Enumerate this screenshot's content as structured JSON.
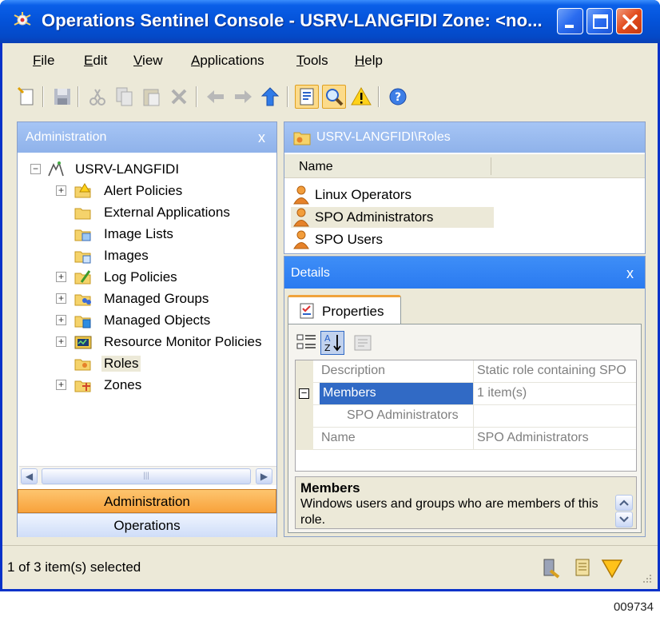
{
  "window": {
    "title": "Operations Sentinel Console - USRV-LANGFIDI  Zone: <no...",
    "minimize_icon": "minimize-icon",
    "maximize_icon": "maximize-icon",
    "close_icon": "close-icon"
  },
  "menu": {
    "items": [
      {
        "label": "File",
        "accel": "F"
      },
      {
        "label": "Edit",
        "accel": "E"
      },
      {
        "label": "View",
        "accel": "V"
      },
      {
        "label": "Applications",
        "accel": "A"
      },
      {
        "label": "Tools",
        "accel": "T"
      },
      {
        "label": "Help",
        "accel": "H"
      }
    ]
  },
  "toolbar": {
    "icons": [
      "new-icon",
      "save-icon",
      "cut-icon",
      "copy-icon",
      "paste-icon",
      "delete-icon",
      "back-icon",
      "forward-icon",
      "up-icon",
      "properties-icon",
      "find-icon",
      "alert-icon",
      "help-icon"
    ]
  },
  "left_pane": {
    "title": "Administration",
    "close_label": "x",
    "tree_root": "USRV-LANGFIDI",
    "tree_items": [
      {
        "label": "Alert Policies",
        "expandable": true
      },
      {
        "label": "External Applications",
        "expandable": false
      },
      {
        "label": "Image Lists",
        "expandable": false
      },
      {
        "label": "Images",
        "expandable": false
      },
      {
        "label": "Log Policies",
        "expandable": true
      },
      {
        "label": "Managed Groups",
        "expandable": true
      },
      {
        "label": "Managed Objects",
        "expandable": true
      },
      {
        "label": "Resource Monitor Policies",
        "expandable": true
      },
      {
        "label": "Roles",
        "expandable": false,
        "selected": true
      },
      {
        "label": "Zones",
        "expandable": true
      }
    ],
    "nav_buttons": {
      "administration": "Administration",
      "operations": "Operations"
    }
  },
  "roles_pane": {
    "title": "USRV-LANGFIDI\\Roles",
    "column_name": "Name",
    "items": [
      "Linux Operators",
      "SPO Administrators",
      "SPO Users"
    ]
  },
  "details": {
    "title": "Details",
    "close_label": "x",
    "tab_label": "Properties",
    "grid": {
      "description_name": "Description",
      "description_value": "Static role containing SPO",
      "members_name": "Members",
      "members_value": "1 item(s)",
      "member_child_name": "SPO Administrators",
      "member_child_value": "",
      "name_name": "Name",
      "name_value": "SPO Administrators",
      "expand_glyph": "−"
    },
    "help": {
      "heading": "Members",
      "body": "Windows users and groups who are members of this role."
    }
  },
  "status": {
    "text": "1 of 3 item(s) selected"
  },
  "figure_code": "009734",
  "colors": {
    "title_bar": "#0452d8",
    "pane_header": "#9dbdf2",
    "details_header": "#3483f4",
    "selection": "#316ac5",
    "active_nav": "#f8a23b"
  }
}
